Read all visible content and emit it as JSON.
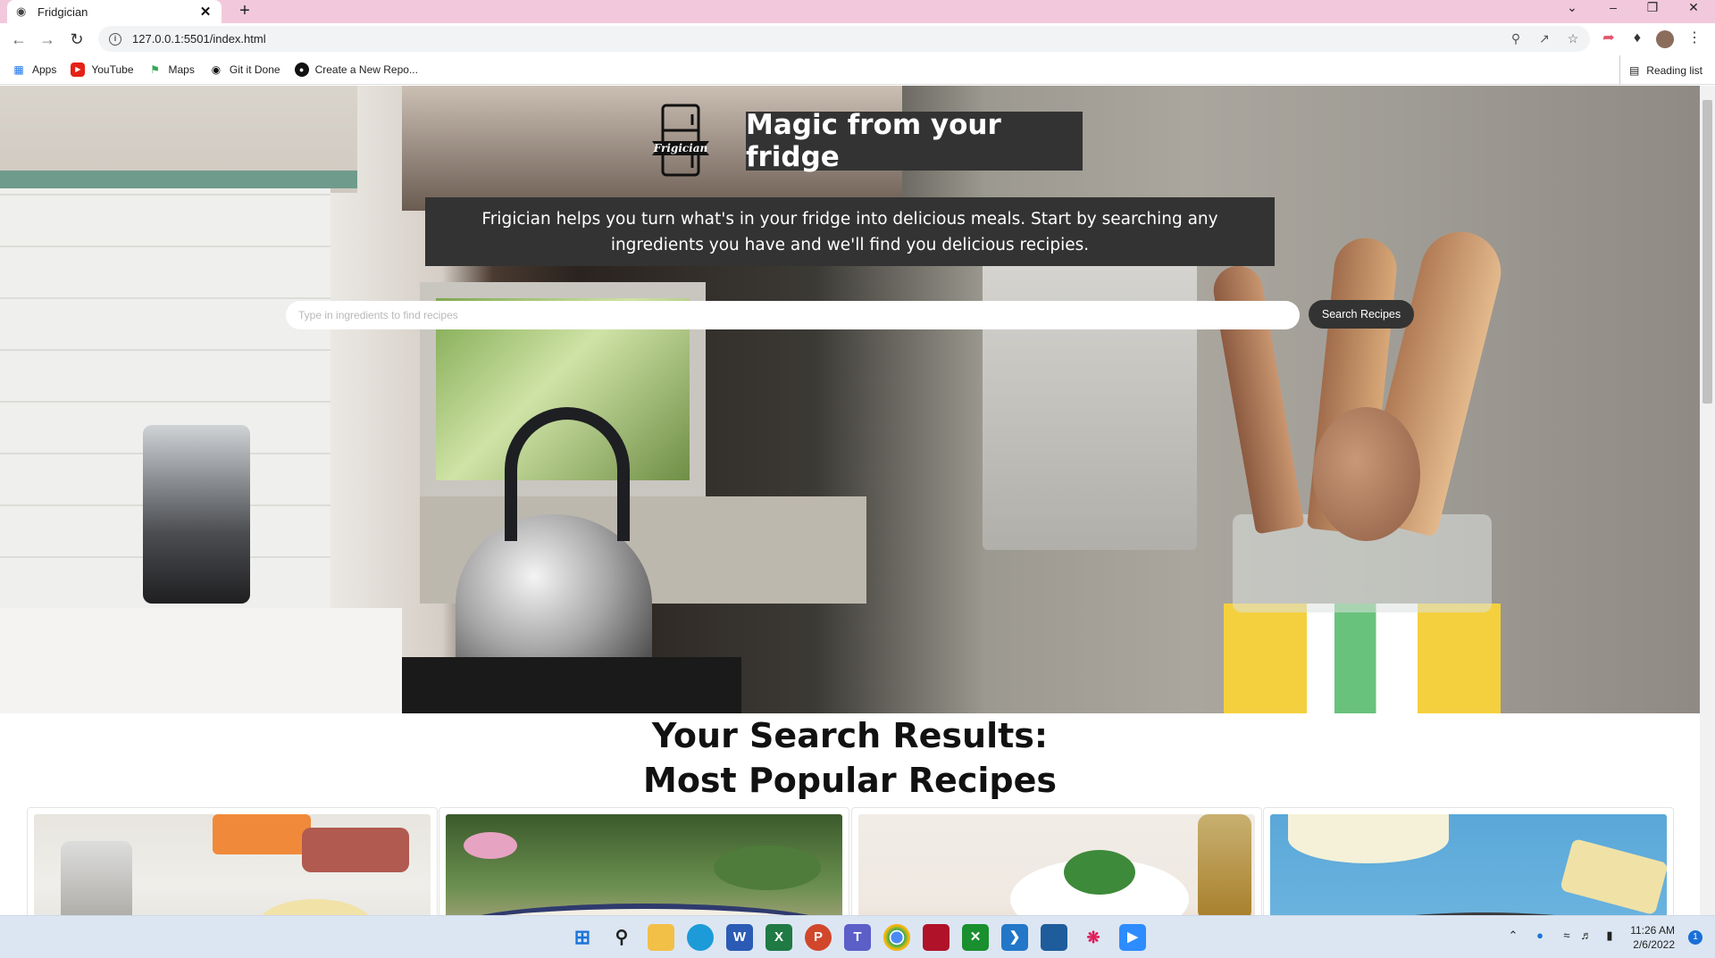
{
  "browser": {
    "tab_title": "Fridgician",
    "url": "127.0.0.1:5501/index.html",
    "bookmarks": [
      {
        "label": "Apps",
        "icon": "apps-grid-icon"
      },
      {
        "label": "YouTube",
        "icon": "youtube-icon"
      },
      {
        "label": "Maps",
        "icon": "maps-icon"
      },
      {
        "label": "Git it Done",
        "icon": "globe-icon"
      },
      {
        "label": "Create a New Repo...",
        "icon": "github-icon"
      }
    ],
    "reading_list": "Reading list"
  },
  "page": {
    "tagline": "Magic from your fridge",
    "intro": "Frigician helps you turn what's in your fridge into delicious meals. Start by searching any ingredients you have and we'll find you delicious recipies.",
    "logo_text": "Frigician",
    "search_placeholder": "Type in ingredients to find recipes",
    "search_button": "Search Recipes",
    "results_heading": "Your Search Results:",
    "popular_heading": "Most Popular Recipes",
    "recipe_cards": [
      {
        "image": "recipe-photo-ingredients"
      },
      {
        "image": "recipe-photo-garden-plate"
      },
      {
        "image": "recipe-photo-salad-oil"
      },
      {
        "image": "recipe-photo-pasta-dough"
      }
    ]
  },
  "taskbar": {
    "time": "11:26 AM",
    "date": "2/6/2022",
    "notifications": "1"
  }
}
